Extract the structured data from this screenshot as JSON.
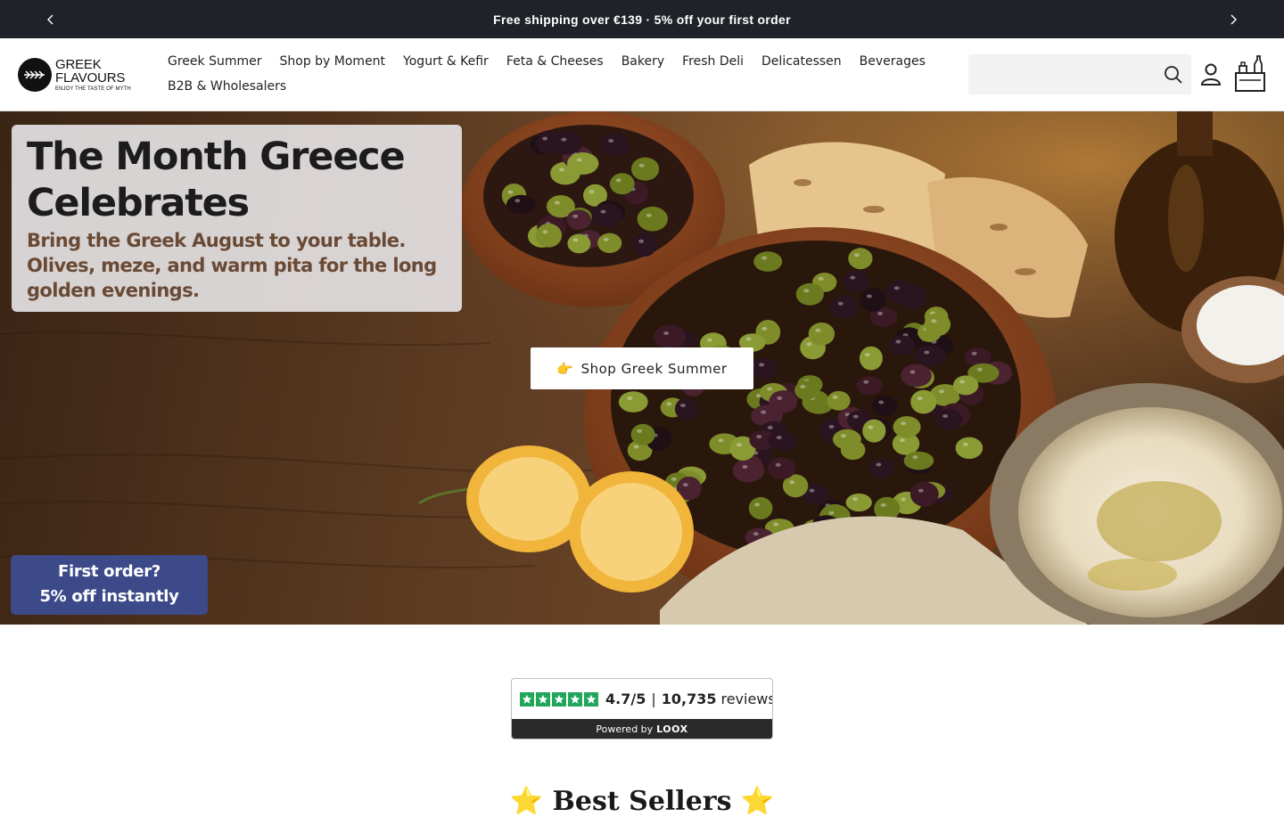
{
  "announcement": {
    "text": "Free shipping over €139 · 5% off your first order",
    "prev_icon": "chevron-left-icon",
    "next_icon": "chevron-right-icon"
  },
  "header": {
    "logo": {
      "line1": "GREEK",
      "line2": "FLAVOURS",
      "tagline": "ENJOY THE TASTE OF MYTH"
    },
    "nav": [
      "Greek Summer",
      "Shop by Moment",
      "Yogurt & Kefir",
      "Feta & Cheeses",
      "Bakery",
      "Fresh Deli",
      "Delicatessen",
      "Beverages",
      "B2B & Wholesalers"
    ],
    "search": {
      "value": "",
      "placeholder": ""
    },
    "icons": [
      "search-icon",
      "account-icon",
      "cart-icon"
    ]
  },
  "hero": {
    "title": "The Month Greece Celebrates",
    "subtitle": "Bring the Greek August to your table. Olives, meze, and warm pita for the long golden evenings.",
    "cta_emoji": "👉",
    "cta_label": "Shop Greek Summer",
    "promo_line1": "First order?",
    "promo_line2": "5% off instantly"
  },
  "reviews": {
    "stars": 5,
    "rating": "4.7/5",
    "separator": "|",
    "count": "10,735",
    "count_label": "reviews",
    "powered_by": "Powered by",
    "brand": "LOOX",
    "accent": "#22a65a"
  },
  "section": {
    "heading": "⭐ Best Sellers ⭐"
  },
  "colors": {
    "announcement_bg": "#1f2329",
    "promo_bg": "#3d4a8a",
    "text_dark": "#222222"
  }
}
